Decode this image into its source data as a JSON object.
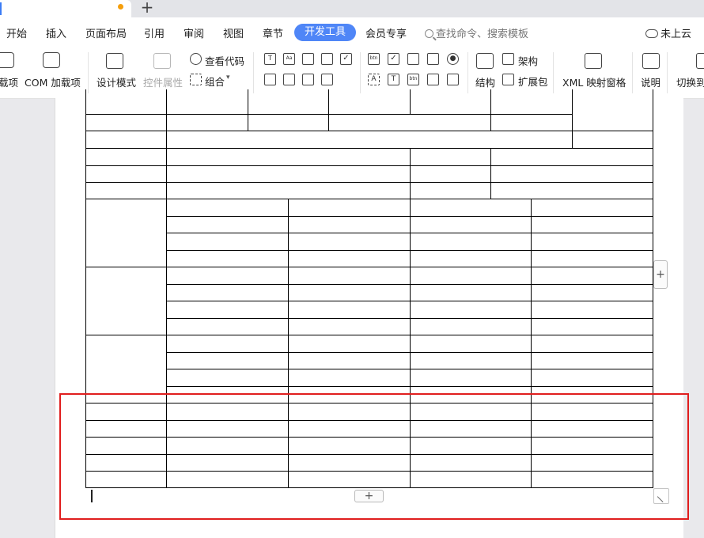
{
  "menu": {
    "items": [
      "开始",
      "插入",
      "页面布局",
      "引用",
      "审阅",
      "视图",
      "章节",
      "开发工具",
      "会员专享"
    ],
    "active": "开发工具",
    "search_placeholder": "查找命令、搜索模板",
    "cloud_status": "未上云"
  },
  "ribbon": {
    "addins_label": "载项",
    "com_addins_label": "COM 加载项",
    "design_mode_label": "设计模式",
    "control_properties_label": "控件属性",
    "view_code_label": "查看代码",
    "group_label": "组合",
    "structure_label": "结构",
    "schema_label": "架构",
    "expansion_pack_label": "扩展包",
    "xml_mapping_label": "XML 映射窗格",
    "help_label": "说明",
    "switch_label": "切换到",
    "control_icons_row1": [
      "T",
      "Aa",
      "img",
      "chk",
      "✓",
      "btn",
      "✓",
      "cbo",
      "lst",
      "●"
    ],
    "control_icons_row2": [
      "grp",
      "frm",
      "opt",
      "tbl",
      "A",
      "T",
      "btn",
      "tgl",
      "spn"
    ]
  },
  "colors": {
    "accent": "#4f86f7",
    "highlight": "#e01e1e",
    "unsaved_dot": "#f59e0b"
  }
}
